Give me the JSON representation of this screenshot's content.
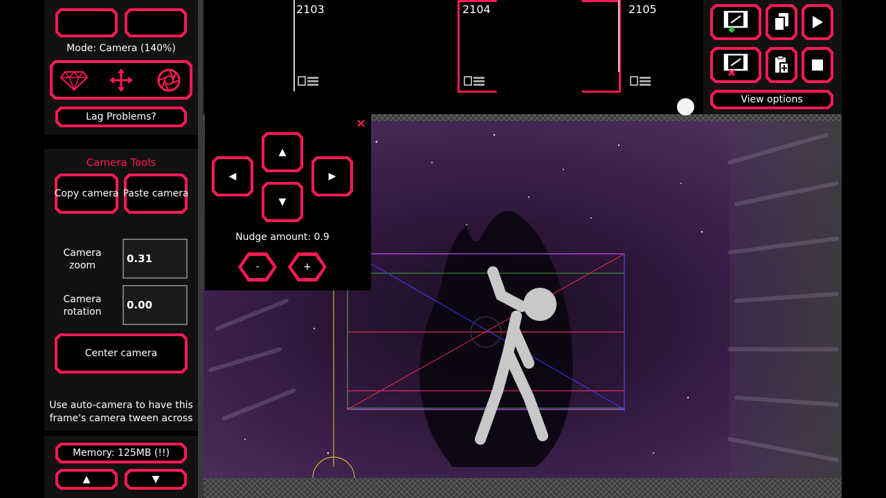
{
  "mode_label": "Mode: Camera (140%)",
  "lag_button": "Lag Problems?",
  "camera_tools": {
    "title": "Camera Tools",
    "copy_label": "Copy camera",
    "paste_label": "Paste camera",
    "zoom_label_line1": "Camera",
    "zoom_label_line2": "zoom",
    "zoom_value": "0.31",
    "rotation_label_line1": "Camera",
    "rotation_label_line2": "rotation",
    "rotation_value": "0.00",
    "center_label": "Center camera",
    "hint_line1": "Use auto-camera to have this",
    "hint_line2": "frame's camera tween across"
  },
  "memory_label": "Memory: 125MB (!!)",
  "timeline": {
    "frames": [
      "2103",
      "2104",
      "2105"
    ]
  },
  "right_panel": {
    "view_options": "View options"
  },
  "nudge": {
    "up": "▲",
    "down": "▼",
    "left": "◀",
    "right": "▶",
    "amount_label": "Nudge amount: 0.9",
    "minus": "-",
    "plus": "+",
    "close": "×"
  },
  "arrows": {
    "up": "▲",
    "down": "▼"
  },
  "colors": {
    "accent": "#ff1a55",
    "panel": "#111111",
    "stage": "#3a1f4a"
  },
  "icons": {
    "mode_diamond": "diamond-icon",
    "mode_move": "move-arrows-icon",
    "mode_camera": "aperture-icon",
    "add_frame": "add-frame-icon",
    "delete_frame": "delete-frame-icon",
    "copy": "copy-icon",
    "paste": "paste-icon",
    "play": "play-icon",
    "stop": "stop-icon"
  }
}
